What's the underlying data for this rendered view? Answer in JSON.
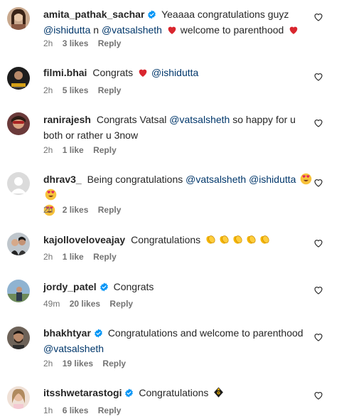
{
  "comments": [
    {
      "username": "amita_pathak_sachar",
      "verified": true,
      "text_1": "Yeaaaa congratulations guyz",
      "mention_1": "@ishidutta",
      "text_2": "n",
      "mention_2": "@vatsalsheth",
      "text_3": "welcome to parenthood",
      "time": "2h",
      "likes": "3 likes",
      "reply": "Reply"
    },
    {
      "username": "filmi.bhai",
      "verified": false,
      "text_1": "Congrats",
      "mention_1": "@ishidutta",
      "time": "2h",
      "likes": "5 likes",
      "reply": "Reply"
    },
    {
      "username": "ranirajesh",
      "verified": false,
      "text_1": "Congrats Vatsal",
      "mention_1": "@vatsalsheth",
      "text_2": "so happy for u both or rather u 3now",
      "time": "2h",
      "likes": "1 like",
      "reply": "Reply"
    },
    {
      "username": "dhrav3_",
      "verified": false,
      "text_1": "Being congratulations",
      "mention_1": "@vatsalsheth",
      "mention_2": "@ishidutta",
      "time": "2h",
      "likes": "2 likes",
      "reply": "Reply"
    },
    {
      "username": "kajolloveloveajay",
      "verified": false,
      "text_1": "Congratulations",
      "time": "2h",
      "likes": "1 like",
      "reply": "Reply"
    },
    {
      "username": "jordy_patel",
      "verified": true,
      "text_1": "Congrats",
      "time": "49m",
      "likes": "20 likes",
      "reply": "Reply"
    },
    {
      "username": "bhakhtyar",
      "verified": true,
      "text_1": "Congratulations and welcome to parenthood",
      "mention_1": "@vatsalsheth",
      "time": "2h",
      "likes": "19 likes",
      "reply": "Reply"
    },
    {
      "username": "itsshwetarastogi",
      "verified": true,
      "text_1": "Congratulations",
      "time": "1h",
      "likes": "6 likes",
      "reply": "Reply"
    }
  ],
  "colors": {
    "text": "#262626",
    "secondary": "#737373",
    "mention": "#00376b",
    "verified": "#0095f6",
    "heart_emoji": "#e0245e"
  },
  "icons": {
    "like": "heart-outline-icon",
    "verified": "verified-badge-icon",
    "red_heart": "red-heart-emoji",
    "heart_eyes": "heart-eyes-emoji",
    "clapping": "clapping-hands-emoji",
    "nazar": "evil-eye-emoji"
  }
}
